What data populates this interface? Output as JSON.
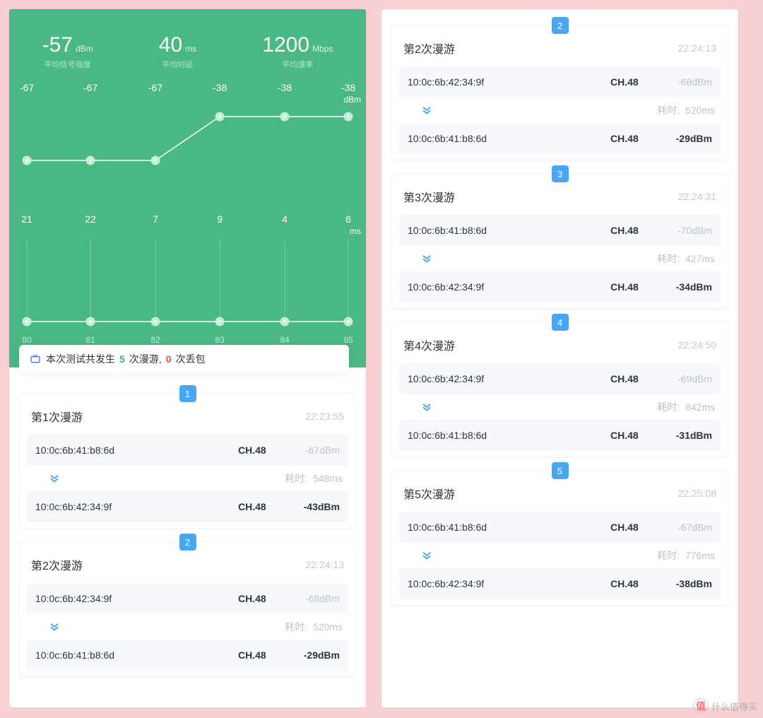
{
  "stats": [
    {
      "value": "-57",
      "unit": "dBm",
      "label": "平均信号强度"
    },
    {
      "value": "40",
      "unit": "ms",
      "label": "平均时延"
    },
    {
      "value": "1200",
      "unit": "Mbps",
      "label": "平均速率"
    }
  ],
  "chart_data": {
    "type": "line",
    "x_ticks": [
      "80",
      "81",
      "82",
      "83",
      "84",
      "85"
    ],
    "series": [
      {
        "name": "dBm",
        "values": [
          -67,
          -67,
          -67,
          -38,
          -38,
          -38
        ],
        "unit": "dBm"
      },
      {
        "name": "ms",
        "values": [
          21,
          22,
          7,
          9,
          4,
          6
        ],
        "unit": "ms"
      }
    ]
  },
  "summary": {
    "prefix": "本次测试共发生",
    "roam_count": "5",
    "roam_label": "次漫游,",
    "loss_count": "0",
    "loss_label": "次丢包"
  },
  "left_cards": [
    {
      "badge": "1",
      "title": "第1次漫游",
      "time": "22:23:55",
      "from": {
        "mac": "10:0c:6b:41:b8:6d",
        "ch": "CH.48",
        "dbm": "-67dBm"
      },
      "latency_label": "耗时:",
      "latency": "548ms",
      "to": {
        "mac": "10:0c:6b:42:34:9f",
        "ch": "CH.48",
        "dbm": "-43dBm"
      }
    },
    {
      "badge": "2",
      "title": "第2次漫游",
      "time": "22:24:13",
      "from": {
        "mac": "10:0c:6b:42:34:9f",
        "ch": "CH.48",
        "dbm": "-68dBm"
      },
      "latency_label": "耗时:",
      "latency": "520ms",
      "to": {
        "mac": "10:0c:6b:41:b8:6d",
        "ch": "CH.48",
        "dbm": "-29dBm"
      }
    }
  ],
  "right_cards": [
    {
      "badge": "2",
      "title": "第2次漫游",
      "time": "22:24:13",
      "from": {
        "mac": "10:0c:6b:42:34:9f",
        "ch": "CH.48",
        "dbm": "-68dBm"
      },
      "latency_label": "耗时:",
      "latency": "520ms",
      "to": {
        "mac": "10:0c:6b:41:b8:6d",
        "ch": "CH.48",
        "dbm": "-29dBm"
      }
    },
    {
      "badge": "3",
      "title": "第3次漫游",
      "time": "22:24:31",
      "from": {
        "mac": "10:0c:6b:41:b8:6d",
        "ch": "CH.48",
        "dbm": "-70dBm"
      },
      "latency_label": "耗时:",
      "latency": "427ms",
      "to": {
        "mac": "10:0c:6b:42:34:9f",
        "ch": "CH.48",
        "dbm": "-34dBm"
      }
    },
    {
      "badge": "4",
      "title": "第4次漫游",
      "time": "22:24:50",
      "from": {
        "mac": "10:0c:6b:42:34:9f",
        "ch": "CH.48",
        "dbm": "-69dBm"
      },
      "latency_label": "耗时:",
      "latency": "842ms",
      "to": {
        "mac": "10:0c:6b:41:b8:6d",
        "ch": "CH.48",
        "dbm": "-31dBm"
      }
    },
    {
      "badge": "5",
      "title": "第5次漫游",
      "time": "22:25:08",
      "from": {
        "mac": "10:0c:6b:41:b8:6d",
        "ch": "CH.48",
        "dbm": "-67dBm"
      },
      "latency_label": "耗时:",
      "latency": "776ms",
      "to": {
        "mac": "10:0c:6b:42:34:9f",
        "ch": "CH.48",
        "dbm": "-38dBm"
      }
    }
  ],
  "watermark": "什么值得买"
}
